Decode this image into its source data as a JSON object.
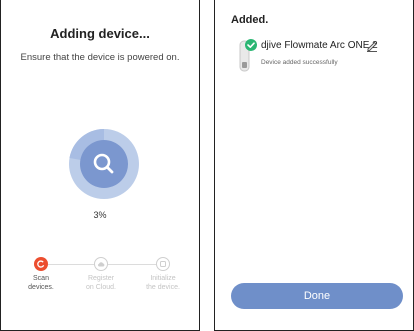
{
  "scan_screen": {
    "title": "Adding device...",
    "subtitle": "Ensure that the device is powered on.",
    "progress_percent": 3,
    "progress_label": "3%",
    "steps": [
      {
        "label_line1": "Scan",
        "label_line2": "devices.",
        "state": "active"
      },
      {
        "label_line1": "Register",
        "label_line2": "on Cloud.",
        "state": "inactive"
      },
      {
        "label_line1": "Initialize",
        "label_line2": "the device.",
        "state": "inactive"
      }
    ]
  },
  "added_screen": {
    "title": "Added.",
    "device_name": "djive Flowmate Arc ONE 2",
    "device_status": "Device added successfully",
    "done_label": "Done"
  },
  "colors": {
    "accent": "#6f8fc9",
    "ring_outer": "#bccde9",
    "ring_inner": "#7b97cf",
    "step_active": "#ec4e2f",
    "success": "#2bb673"
  },
  "icons": [
    "search-icon",
    "check-icon",
    "edit-icon",
    "cloud-icon",
    "initialize-icon"
  ]
}
